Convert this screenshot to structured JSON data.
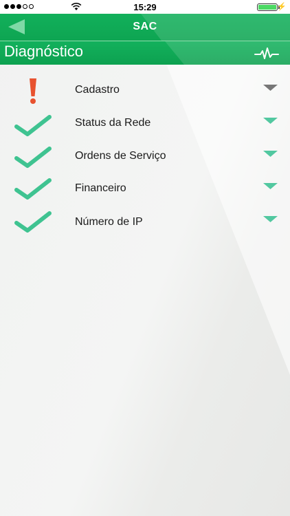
{
  "status_bar": {
    "time": "15:29",
    "signal_bars": 3,
    "signal_total": 5,
    "battery_level": 1.0
  },
  "nav": {
    "title": "SAC",
    "back_icon": "back-arrow-icon"
  },
  "section": {
    "title": "Diagnóstico",
    "icon": "heartbeat-pulse-icon"
  },
  "colors": {
    "brand_green": "#0ea552",
    "check_green": "#3fc391",
    "alert_red": "#e8522f",
    "chevron_teal": "#52c8a0",
    "chevron_gray": "#777777"
  },
  "items": [
    {
      "label": "Cadastro",
      "status": "error"
    },
    {
      "label": "Status da Rede",
      "status": "ok"
    },
    {
      "label": "Ordens de Serviço",
      "status": "ok"
    },
    {
      "label": "Financeiro",
      "status": "ok"
    },
    {
      "label": "Número de IP",
      "status": "ok"
    }
  ]
}
